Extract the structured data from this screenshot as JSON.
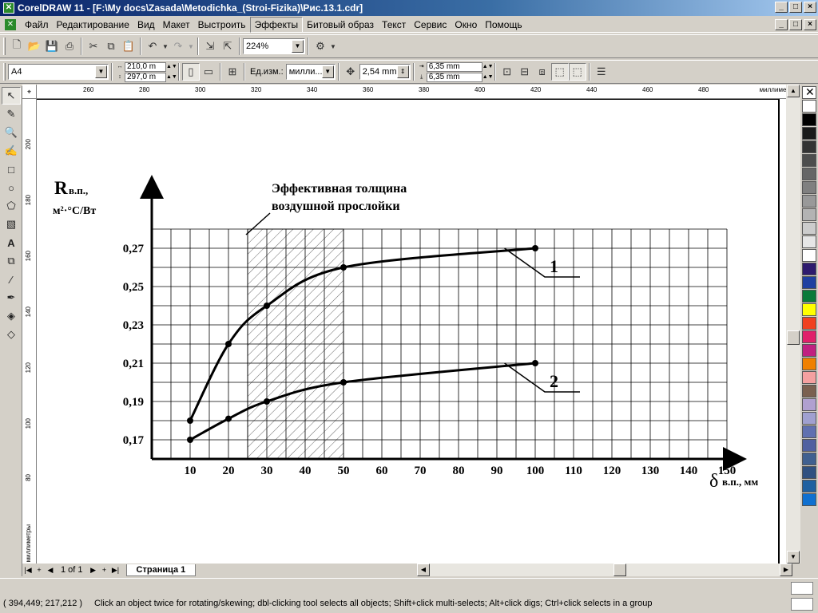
{
  "window": {
    "title": "CorelDRAW 11 - [F:\\My docs\\Zasada\\Metodichka_(Stroi-Fizika)\\Рис.13.1.cdr]"
  },
  "menu": [
    "Файл",
    "Редактирование",
    "Вид",
    "Макет",
    "Выстроить",
    "Эффекты",
    "Битовый образ",
    "Текст",
    "Сервис",
    "Окно",
    "Помощь"
  ],
  "toolbar": {
    "zoom": "224%"
  },
  "propertybar": {
    "paper": "A4",
    "width": "210,0 m",
    "height": "297,0 m",
    "units_label": "Ед.изм.:",
    "units": "милли...",
    "nudge": "2,54 mm",
    "dup_x": "6,35 mm",
    "dup_y": "6,35 mm"
  },
  "ruler": {
    "h_ticks": [
      "260",
      "280",
      "300",
      "320",
      "340",
      "360",
      "380",
      "400",
      "420",
      "440",
      "460",
      "480"
    ],
    "h_unit": "миллиметры",
    "v_ticks": [
      "200",
      "180",
      "160",
      "140",
      "120",
      "100",
      "80"
    ],
    "v_unit": "миллиметры"
  },
  "chart_data": {
    "type": "line",
    "ylabel_main": "R",
    "ylabel_sub": "в.п.",
    "ylabel_unit": "м²·°С/Вт",
    "xlabel_main": "δ",
    "xlabel_sub": "в.п., мм",
    "annotation": "Эффективная толщина воздушной прослойки",
    "annotation_line1": "Эффективная толщина",
    "annotation_line2": "воздушной прослойки",
    "hatched_range": [
      25,
      50
    ],
    "xlim": [
      0,
      150
    ],
    "ylim": [
      0.16,
      0.27
    ],
    "x_ticks": [
      "10",
      "20",
      "30",
      "40",
      "50",
      "60",
      "70",
      "80",
      "90",
      "100",
      "110",
      "120",
      "130",
      "140",
      "150"
    ],
    "y_ticks": [
      "0,17",
      "0,19",
      "0,21",
      "0,23",
      "0,25",
      "0,27"
    ],
    "series": [
      {
        "name": "1",
        "x": [
          10,
          20,
          30,
          50,
          100
        ],
        "y": [
          0.18,
          0.22,
          0.24,
          0.26,
          0.27
        ]
      },
      {
        "name": "2",
        "x": [
          10,
          20,
          30,
          50,
          100
        ],
        "y": [
          0.17,
          0.181,
          0.19,
          0.2,
          0.21
        ]
      }
    ]
  },
  "pager": {
    "count": "1 of 1",
    "tab": "Страница 1"
  },
  "status": {
    "coords": "( 394,449; 217,212 )",
    "hint": "Click an object twice for rotating/skewing; dbl-clicking tool selects all objects; Shift+click multi-selects; Alt+click digs; Ctrl+click selects in a group"
  },
  "palette": [
    "#ffffff",
    "#000000",
    "#1a1a1a",
    "#333333",
    "#4d4d4d",
    "#666666",
    "#808080",
    "#999999",
    "#b3b3b3",
    "#cccccc",
    "#e6e6e6",
    "#ffffff",
    "#2e1a6e",
    "#1f3fa0",
    "#0a7a3a",
    "#ffff00",
    "#f04020",
    "#e0206a",
    "#c02080",
    "#f08000",
    "#f4a0a0",
    "#7a6050",
    "#b0a0d0",
    "#a0a0d0",
    "#6070b0",
    "#5060a0",
    "#406090",
    "#305080",
    "#2060a0",
    "#1070d0"
  ]
}
